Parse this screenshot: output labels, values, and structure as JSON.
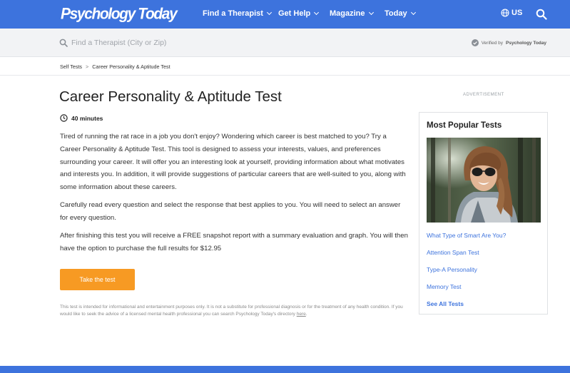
{
  "nav": {
    "logo": "Psychology Today",
    "items": [
      {
        "label": "Find a Therapist"
      },
      {
        "label": "Get Help"
      },
      {
        "label": "Magazine"
      },
      {
        "label": "Today"
      }
    ],
    "region": "US"
  },
  "search": {
    "placeholder": "Find a Therapist (City or Zip)",
    "verified_prefix": "Verified by",
    "verified_by": "Psychology Today"
  },
  "breadcrumb": {
    "parent": "Self Tests",
    "separator": ">",
    "current": "Career Personality & Aptitude Test"
  },
  "main": {
    "title": "Career Personality & Aptitude Test",
    "duration": "40 minutes",
    "paragraphs": [
      "Tired of running the rat race in a job you don't enjoy? Wondering which career is best matched to you? Try a Career Personality & Aptitude Test. This tool is designed to assess your interests, values, and preferences surrounding your career. It will offer you an interesting look at yourself, providing information about what motivates and interests you. In addition, it will provide suggestions of particular careers that are well-suited to you, along with some information about these careers.",
      "Carefully read every question and select the response that best applies to you. You will need to select an answer for every question.",
      "After finishing this test you will receive a FREE snapshot report with a summary evaluation and graph. You will then have the option to purchase the full results for $12.95"
    ],
    "cta_label": "Take the test",
    "disclaimer": "This test is intended for informational and entertainment purposes only. It is not a substitute for professional diagnosis or for the treatment of any health condition. If you would like to seek the advice of a licensed mental health professional you can search Psychology Today's directory",
    "disclaimer_link": "here",
    "disclaimer_end": "."
  },
  "sidebar": {
    "ad_label": "ADVERTISEMENT",
    "heading": "Most Popular Tests",
    "links": [
      {
        "label": "What Type of Smart Are You?"
      },
      {
        "label": "Attention Span Test"
      },
      {
        "label": "Type-A Personality"
      },
      {
        "label": "Memory Test"
      },
      {
        "label": "See All Tests"
      }
    ]
  },
  "colors": {
    "brand_blue": "#3d73dd",
    "cta_orange": "#f79a23"
  }
}
